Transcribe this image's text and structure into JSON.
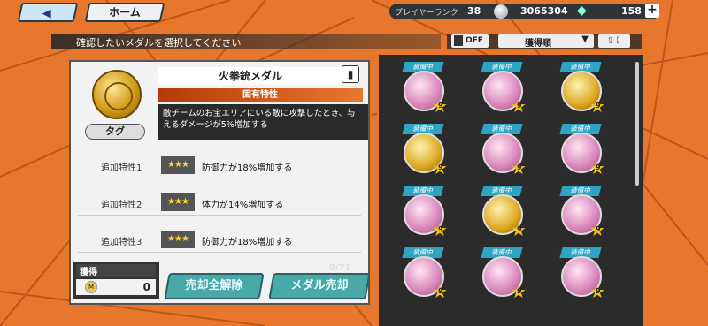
{
  "nav": {
    "back_icon": "left-arrow-icon",
    "home_label": "ホーム"
  },
  "status": {
    "rank_label": "プレイヤーランク",
    "rank_value": "38",
    "coin_value": "3065304",
    "gem_value": "158",
    "plus_label": "+"
  },
  "header": {
    "instruction": "確認したいメダルを選択してください",
    "favorite_toggle": "OFF",
    "sort_label": "獲得順",
    "order_icon": "⇧⇩"
  },
  "medal": {
    "name": "火拳銃メダル",
    "tag_label": "タグ",
    "inherent_title": "固有特性",
    "inherent_desc": "敵チームのお宝エリアにいる敵に攻撃したとき、与えるダメージが5%増加する",
    "traits": [
      {
        "label": "追加特性1",
        "stars": "★★★",
        "desc": "防御力が18%増加する"
      },
      {
        "label": "追加特性2",
        "stars": "★★★",
        "desc": "体力が14%増加する"
      },
      {
        "label": "追加特性3",
        "stars": "★★★",
        "desc": "防御力が18%増加する"
      }
    ]
  },
  "bottom": {
    "own_label": "獲得",
    "own_value": "0",
    "count_label": "0/71",
    "release_all_label": "売却全解除",
    "sell_label": "メダル売却"
  },
  "grid": {
    "equip_label": "装備中",
    "items": [
      {
        "kind": "pink",
        "star": "9"
      },
      {
        "kind": "pink",
        "star": "9"
      },
      {
        "kind": "gold",
        "star": "9"
      },
      {
        "kind": "gold",
        "star": "9"
      },
      {
        "kind": "pink",
        "star": "9"
      },
      {
        "kind": "pink",
        "star": "9"
      },
      {
        "kind": "pink",
        "star": "9"
      },
      {
        "kind": "gold",
        "star": "9"
      },
      {
        "kind": "pink",
        "star": "9"
      },
      {
        "kind": "pink",
        "star": "9"
      },
      {
        "kind": "pink",
        "star": "9"
      },
      {
        "kind": "pink",
        "star": "9"
      }
    ]
  }
}
